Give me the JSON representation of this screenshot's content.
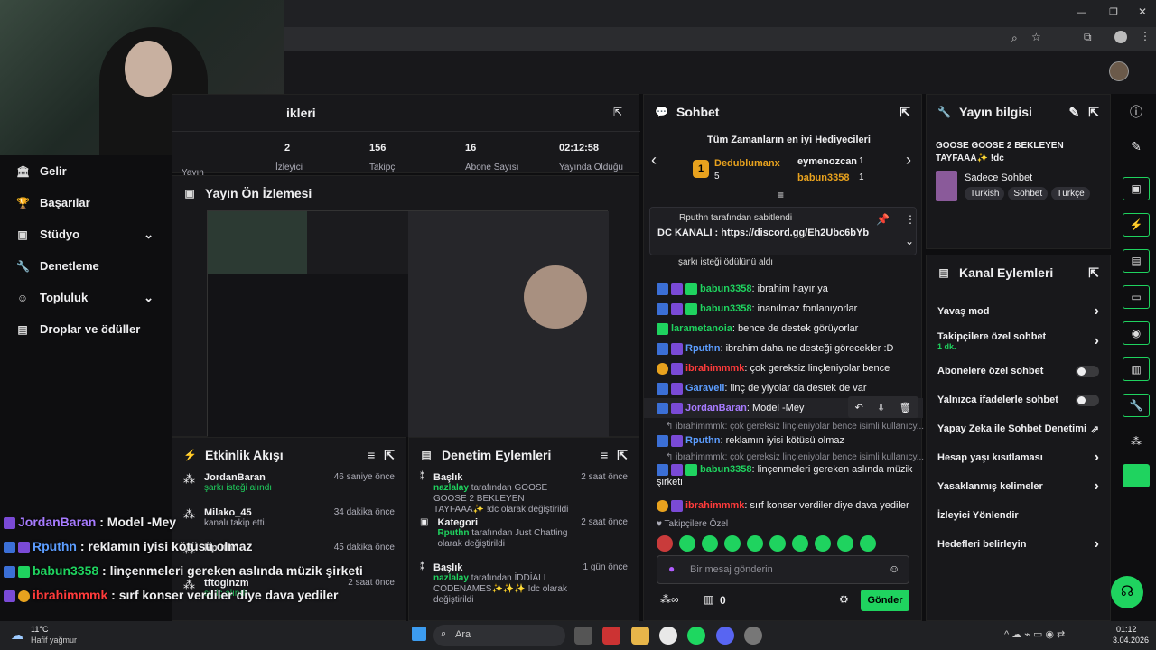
{
  "browser": {
    "controls": [
      "—",
      "❐",
      "✕"
    ]
  },
  "header": {
    "avatar_icon": "avatar-icon"
  },
  "nav": {
    "items": [
      {
        "label": "Gelir",
        "icon": "bank-icon"
      },
      {
        "label": "Başarılar",
        "icon": "trophy-icon"
      },
      {
        "label": "Stüdyo",
        "icon": "studio-icon"
      },
      {
        "label": "Denetleme",
        "icon": "wrench-icon"
      },
      {
        "label": "Topluluk",
        "icon": "community-icon"
      },
      {
        "label": "Droplar ve ödüller",
        "icon": "gift-icon"
      }
    ]
  },
  "stats": {
    "title": "ikleri",
    "cells": [
      {
        "value": "",
        "label": "Yayın"
      },
      {
        "value": "2",
        "label": "İzleyici"
      },
      {
        "value": "156",
        "label": "Takipçi"
      },
      {
        "value": "16",
        "label": "Abone Sayısı"
      },
      {
        "value": "02:12:58",
        "label": "Yayında Olduğu"
      }
    ]
  },
  "preview": {
    "title": "Yayın Ön İzlemesi"
  },
  "activity": {
    "title": "Etkinlik Akışı",
    "items": [
      {
        "name": "JordanBaran",
        "sub": "şarkı isteği alındı",
        "time": "46 saniye önce"
      },
      {
        "name": "Milako_45",
        "sub": "kanalı takip etti",
        "time": "34 dakika önce"
      },
      {
        "name": "Rputhn",
        "sub": "",
        "time": "45 dakika önce"
      },
      {
        "name": "tftoglnzm",
        "sub": "su iç alındı",
        "time": "2 saat önce"
      }
    ]
  },
  "modactions": {
    "title": "Denetim Eylemleri",
    "items": [
      {
        "heading": "Başlık",
        "time": "2 saat önce",
        "user": "nazlalay",
        "text": " tarafından GOOSE GOOSE 2 BEKLEYEN TAYFAAA✨ !dc olarak değiştirildi"
      },
      {
        "heading": "Kategori",
        "time": "2 saat önce",
        "user": "Rputhn",
        "text": " tarafından Just Chatting olarak değiştirildi"
      },
      {
        "heading": "Başlık",
        "time": "1 gün önce",
        "user": "nazlalay",
        "text": " tarafından İDDİALI CODENAMES✨✨✨ !dc olarak değiştirildi"
      }
    ]
  },
  "chat": {
    "title": "Sohbet",
    "gifters_title": "Tüm Zamanların en iyi Hediyecileri",
    "gifters": [
      {
        "rank": "1",
        "name": "Dedublumanx",
        "count": "5"
      },
      {
        "rank": "",
        "name": "eymenozcan",
        "count": "1"
      },
      {
        "rank": "",
        "name": "babun3358",
        "count": "1"
      }
    ],
    "pinned_by": "Rputhn tarafından sabitlendi",
    "pinned_label": "DC KANALI : ",
    "pinned_link": "https://discord.gg/Eh2Ubc6bYb",
    "partial": "şarkı isteği ödülünü aldı",
    "messages": [
      {
        "user": "babun3358",
        "color": "#1fd35f",
        "text": ": ibrahim hayır ya"
      },
      {
        "user": "babun3358",
        "color": "#1fd35f",
        "text": ": inanılmaz fonlanıyorlar"
      },
      {
        "user": "larametanoia",
        "color": "#1fd35f",
        "text": ": bence de destek görüyorlar"
      },
      {
        "user": "Rputhn",
        "color": "#5c9dff",
        "text": ": ibrahim daha ne desteği görecekler :D"
      },
      {
        "user": "ibrahimmmk",
        "color": "#ff3b3b",
        "text": ": çok gereksiz linçleniyolar bence"
      },
      {
        "user": "Garaveli",
        "color": "#5c9dff",
        "text": ": linç de yiyolar da destek de var"
      },
      {
        "user": "JordanBaran",
        "color": "#a77bff",
        "text": ": Model -Mey"
      }
    ],
    "reply1": "↰ ibrahimmmk: çok gereksiz linçleniyolar bence isimli kullanıcy...",
    "msg8": {
      "user": "Rputhn",
      "text": ": reklamın iyisi kötüsü olmaz"
    },
    "reply2": "↰ ibrahimmmk: çok gereksiz linçleniyolar bence isimli kullanıcy...",
    "msg9": {
      "user": "babun3358",
      "text": ": linçenmeleri gereken aslında müzik şirketi"
    },
    "msg10": {
      "user": "ibrahimmmk",
      "text": ": sırf konser verdiler diye dava yediler"
    },
    "followers_only": "Takipçilere Özel",
    "input_placeholder": "Bir mesaj gönderin",
    "points": "0",
    "send": "Gönder"
  },
  "info": {
    "title": "Yayın bilgisi",
    "stream_title": "GOOSE GOOSE 2 BEKLEYEN TAYFAAA✨ !dc",
    "category": "Sadece Sohbet",
    "tags": [
      "Turkish",
      "Sohbet",
      "Türkçe"
    ]
  },
  "channel": {
    "title": "Kanal Eylemleri",
    "rows": [
      {
        "label": "Yavaş mod",
        "control": "arrow"
      },
      {
        "label": "Takipçilere özel sohbet",
        "sub": "1 dk.",
        "control": "arrow"
      },
      {
        "label": "Abonelere özel sohbet",
        "control": "toggle"
      },
      {
        "label": "Yalnızca ifadelerle sohbet",
        "control": "toggle"
      },
      {
        "label": "Yapay Zeka ile Sohbet Denetimi",
        "control": "external"
      },
      {
        "label": "Hesap yaşı kısıtlaması",
        "control": "arrow"
      },
      {
        "label": "Yasaklanmış kelimeler",
        "control": "arrow"
      },
      {
        "label": "İzleyici Yönlendir",
        "control": "none"
      },
      {
        "label": "Hedefleri belirleyin",
        "control": "arrow"
      }
    ]
  },
  "overlay": {
    "lines": [
      {
        "user": "JordanBaran",
        "color": "#a77bff",
        "text": " : Model -Mey"
      },
      {
        "user": "Rputhn",
        "color": "#5c9dff",
        "text": " : reklamın iyisi kötüsü olmaz"
      },
      {
        "user": "babun3358",
        "color": "#1fd35f",
        "text": " : linçenmeleri gereken aslında müzik şirketi"
      },
      {
        "user": "ibrahimmmk",
        "color": "#ff3b3b",
        "text": " : sırf konser verdiler diye dava yediler"
      }
    ]
  },
  "taskbar": {
    "weather_temp": "11°C",
    "weather_desc": "Hafif yağmur",
    "search": "Ara",
    "time": "01:12",
    "date": "3.04.2026"
  },
  "colors": {
    "accent": "#1fd35f",
    "bg": "#0e0e10",
    "panel": "#18181b"
  }
}
